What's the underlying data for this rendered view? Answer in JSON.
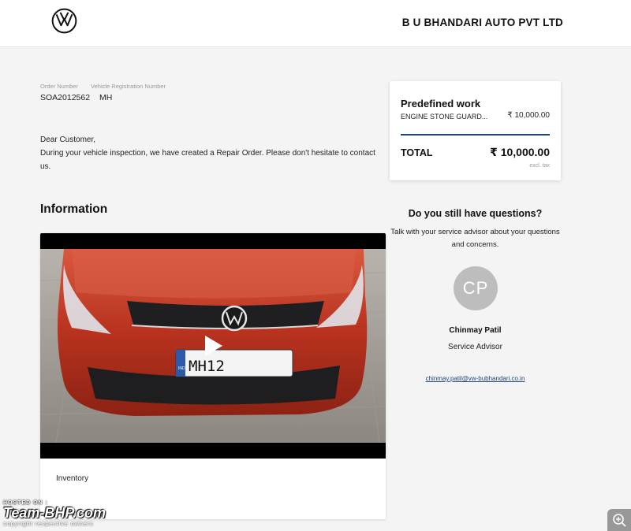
{
  "header": {
    "logo_icon": "vw-logo-icon",
    "dealer_name": "B U BHANDARI AUTO PVT LTD"
  },
  "order": {
    "order_number_label": "Order Number",
    "registration_label": "Vehicle Registration Number",
    "order_number": "SOA2012562",
    "registration": "MH"
  },
  "letter": {
    "greeting": "Dear Customer,",
    "body": "During your vehicle inspection, we have created a Repair Order. Please don't hesitate to contact us."
  },
  "information": {
    "heading": "Information",
    "video_icon": "play-icon",
    "plate_text": "MH12",
    "plate_country": "IND",
    "caption": "Inventory"
  },
  "summary": {
    "section_title": "Predefined work",
    "item_name": "ENGINE STONE GUARD...",
    "item_price": "₹ 10,000.00",
    "total_label": "TOTAL",
    "total_value": "₹ 10,000.00",
    "tax_note": "excl. tax",
    "accent_color": "#20457a"
  },
  "contact": {
    "title": "Do you still have questions?",
    "text": "Talk with your service advisor about your questions and concerns.",
    "initials": "CP",
    "name": "Chinmay Patil",
    "role": "Service Advisor",
    "email": "chinmay.patil@vw-bubhandari.co.in"
  },
  "watermark": {
    "hosted": "HOSTED ON :",
    "brand": "Team-BHP.com",
    "copyright": "copyright respective owners"
  },
  "zoom": {
    "icon": "zoom-in-icon"
  }
}
